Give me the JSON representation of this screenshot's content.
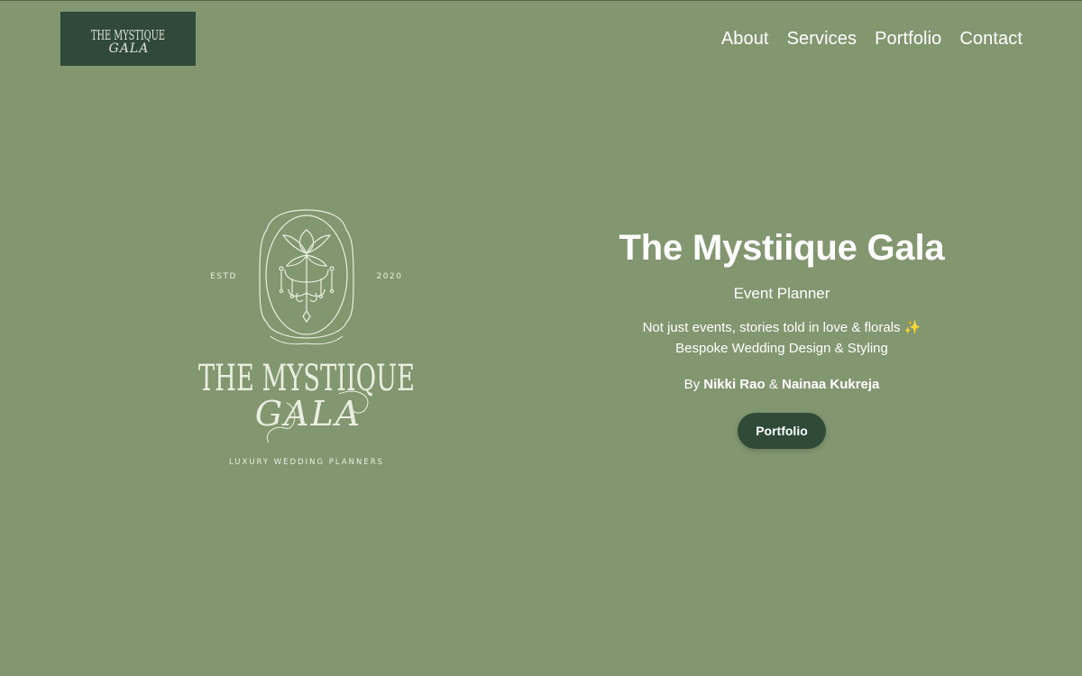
{
  "header": {
    "logo": {
      "line1": "THE MYSTIQUE",
      "line2": "GALA",
      "background_color": "#30493a"
    },
    "nav": [
      {
        "label": "About"
      },
      {
        "label": "Services"
      },
      {
        "label": "Portfolio"
      },
      {
        "label": "Contact"
      }
    ]
  },
  "hero": {
    "emblem": {
      "estd_label": "ESTD",
      "year": "2020",
      "name_line1": "THE MYSTIIQUE",
      "name_line2": "GALA",
      "tagline": "LUXURY WEDDING PLANNERS",
      "icon": "chandelier-floral-frame-icon"
    },
    "title": "The Mystiique Gala",
    "subtitle": "Event Planner",
    "tagline_line1": "Not just events, stories told in love & florals",
    "sparkle": "✨",
    "tagline_line2": "Bespoke Wedding Design & Styling",
    "byline_prefix": "By",
    "founder_1": "Nikki Rao",
    "byline_joiner": "&",
    "founder_2": "Nainaa Kukreja",
    "cta_label": "Portfolio"
  },
  "colors": {
    "page_background": "#829670",
    "dark_green": "#2f4a37",
    "text": "#ffffff",
    "emblem_line": "#e9efe0"
  }
}
